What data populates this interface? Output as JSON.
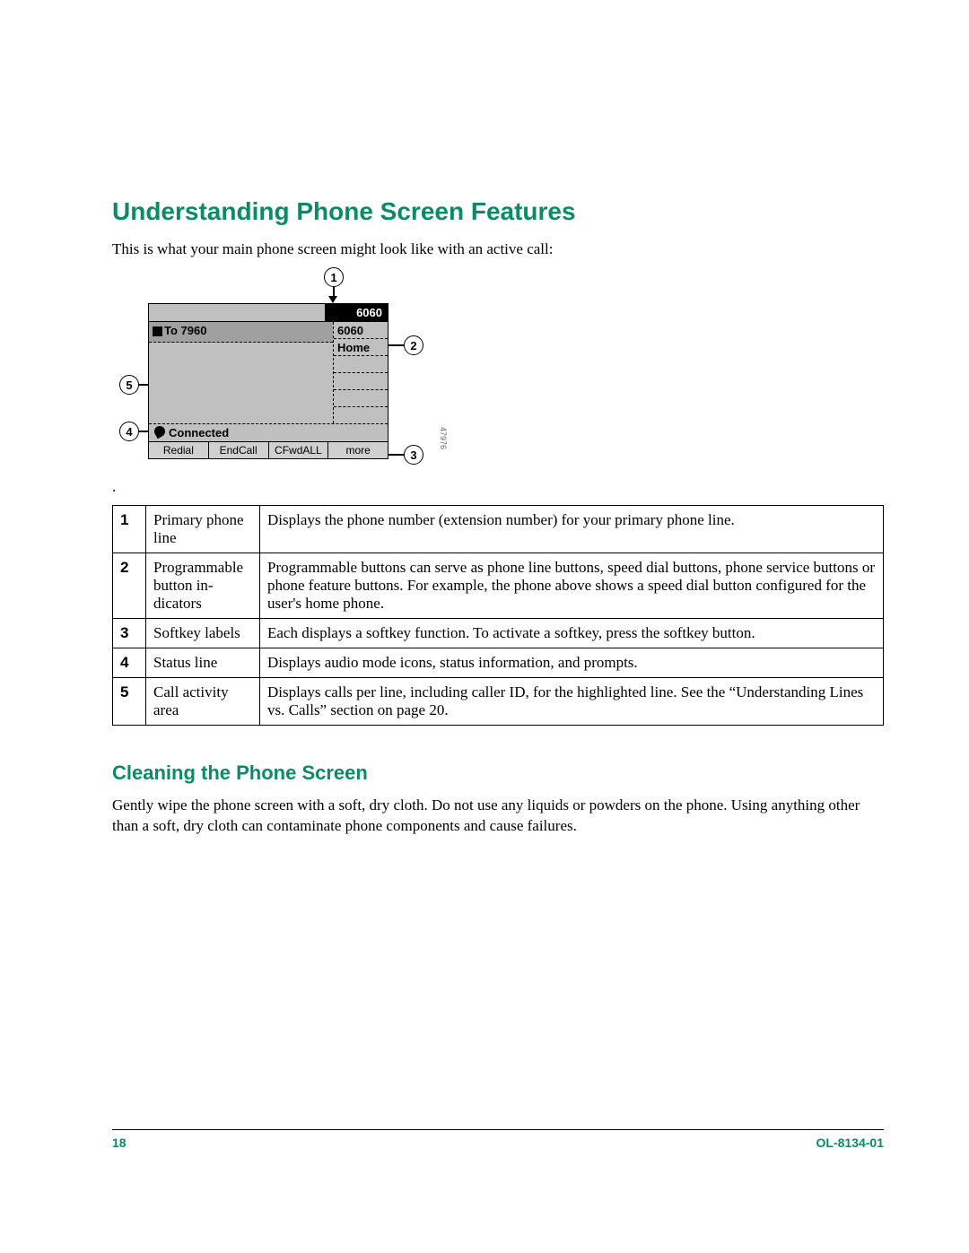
{
  "heading1": "Understanding Phone Screen Features",
  "intro": "This is what your main phone screen might look like with an active call:",
  "diagram": {
    "header_number": "6060",
    "call_to": "To 7960",
    "right_cells": [
      "6060",
      "Home",
      "",
      "",
      "",
      ""
    ],
    "status": "Connected",
    "softkeys": [
      "Redial",
      "EndCall",
      "CFwdALL",
      "more"
    ],
    "callouts": {
      "c1": "1",
      "c2": "2",
      "c3": "3",
      "c4": "4",
      "c5": "5"
    },
    "diag_id": "47976"
  },
  "table": [
    {
      "n": "1",
      "term": "Primary phone line",
      "desc": "Displays the phone number (extension number) for your primary phone line."
    },
    {
      "n": "2",
      "term": "Programma­ble button in­dicators",
      "desc": "Programmable buttons can serve as phone line buttons, speed dial buttons, phone service buttons or phone feature buttons. For example, the phone above shows a speed dial button configured for the user's home phone."
    },
    {
      "n": "3",
      "term": "Softkey labels",
      "desc": "Each displays a softkey function. To activate a softkey, press the softkey button."
    },
    {
      "n": "4",
      "term": "Status line",
      "desc": "Displays audio mode icons, status information, and prompts."
    },
    {
      "n": "5",
      "term": "Call activity area",
      "desc": "Displays calls per line, including caller ID, for the highlighted line. See the “Un­derstanding Lines vs. Calls” section on page 20."
    }
  ],
  "heading2": "Cleaning the Phone Screen",
  "para2": "Gently wipe the phone screen with a soft, dry cloth. Do not use any liquids or powders on the phone. Using anything other than a soft, dry cloth can contaminate phone components and cause failures.",
  "footer": {
    "page": "18",
    "doc": "OL-8134-01"
  }
}
